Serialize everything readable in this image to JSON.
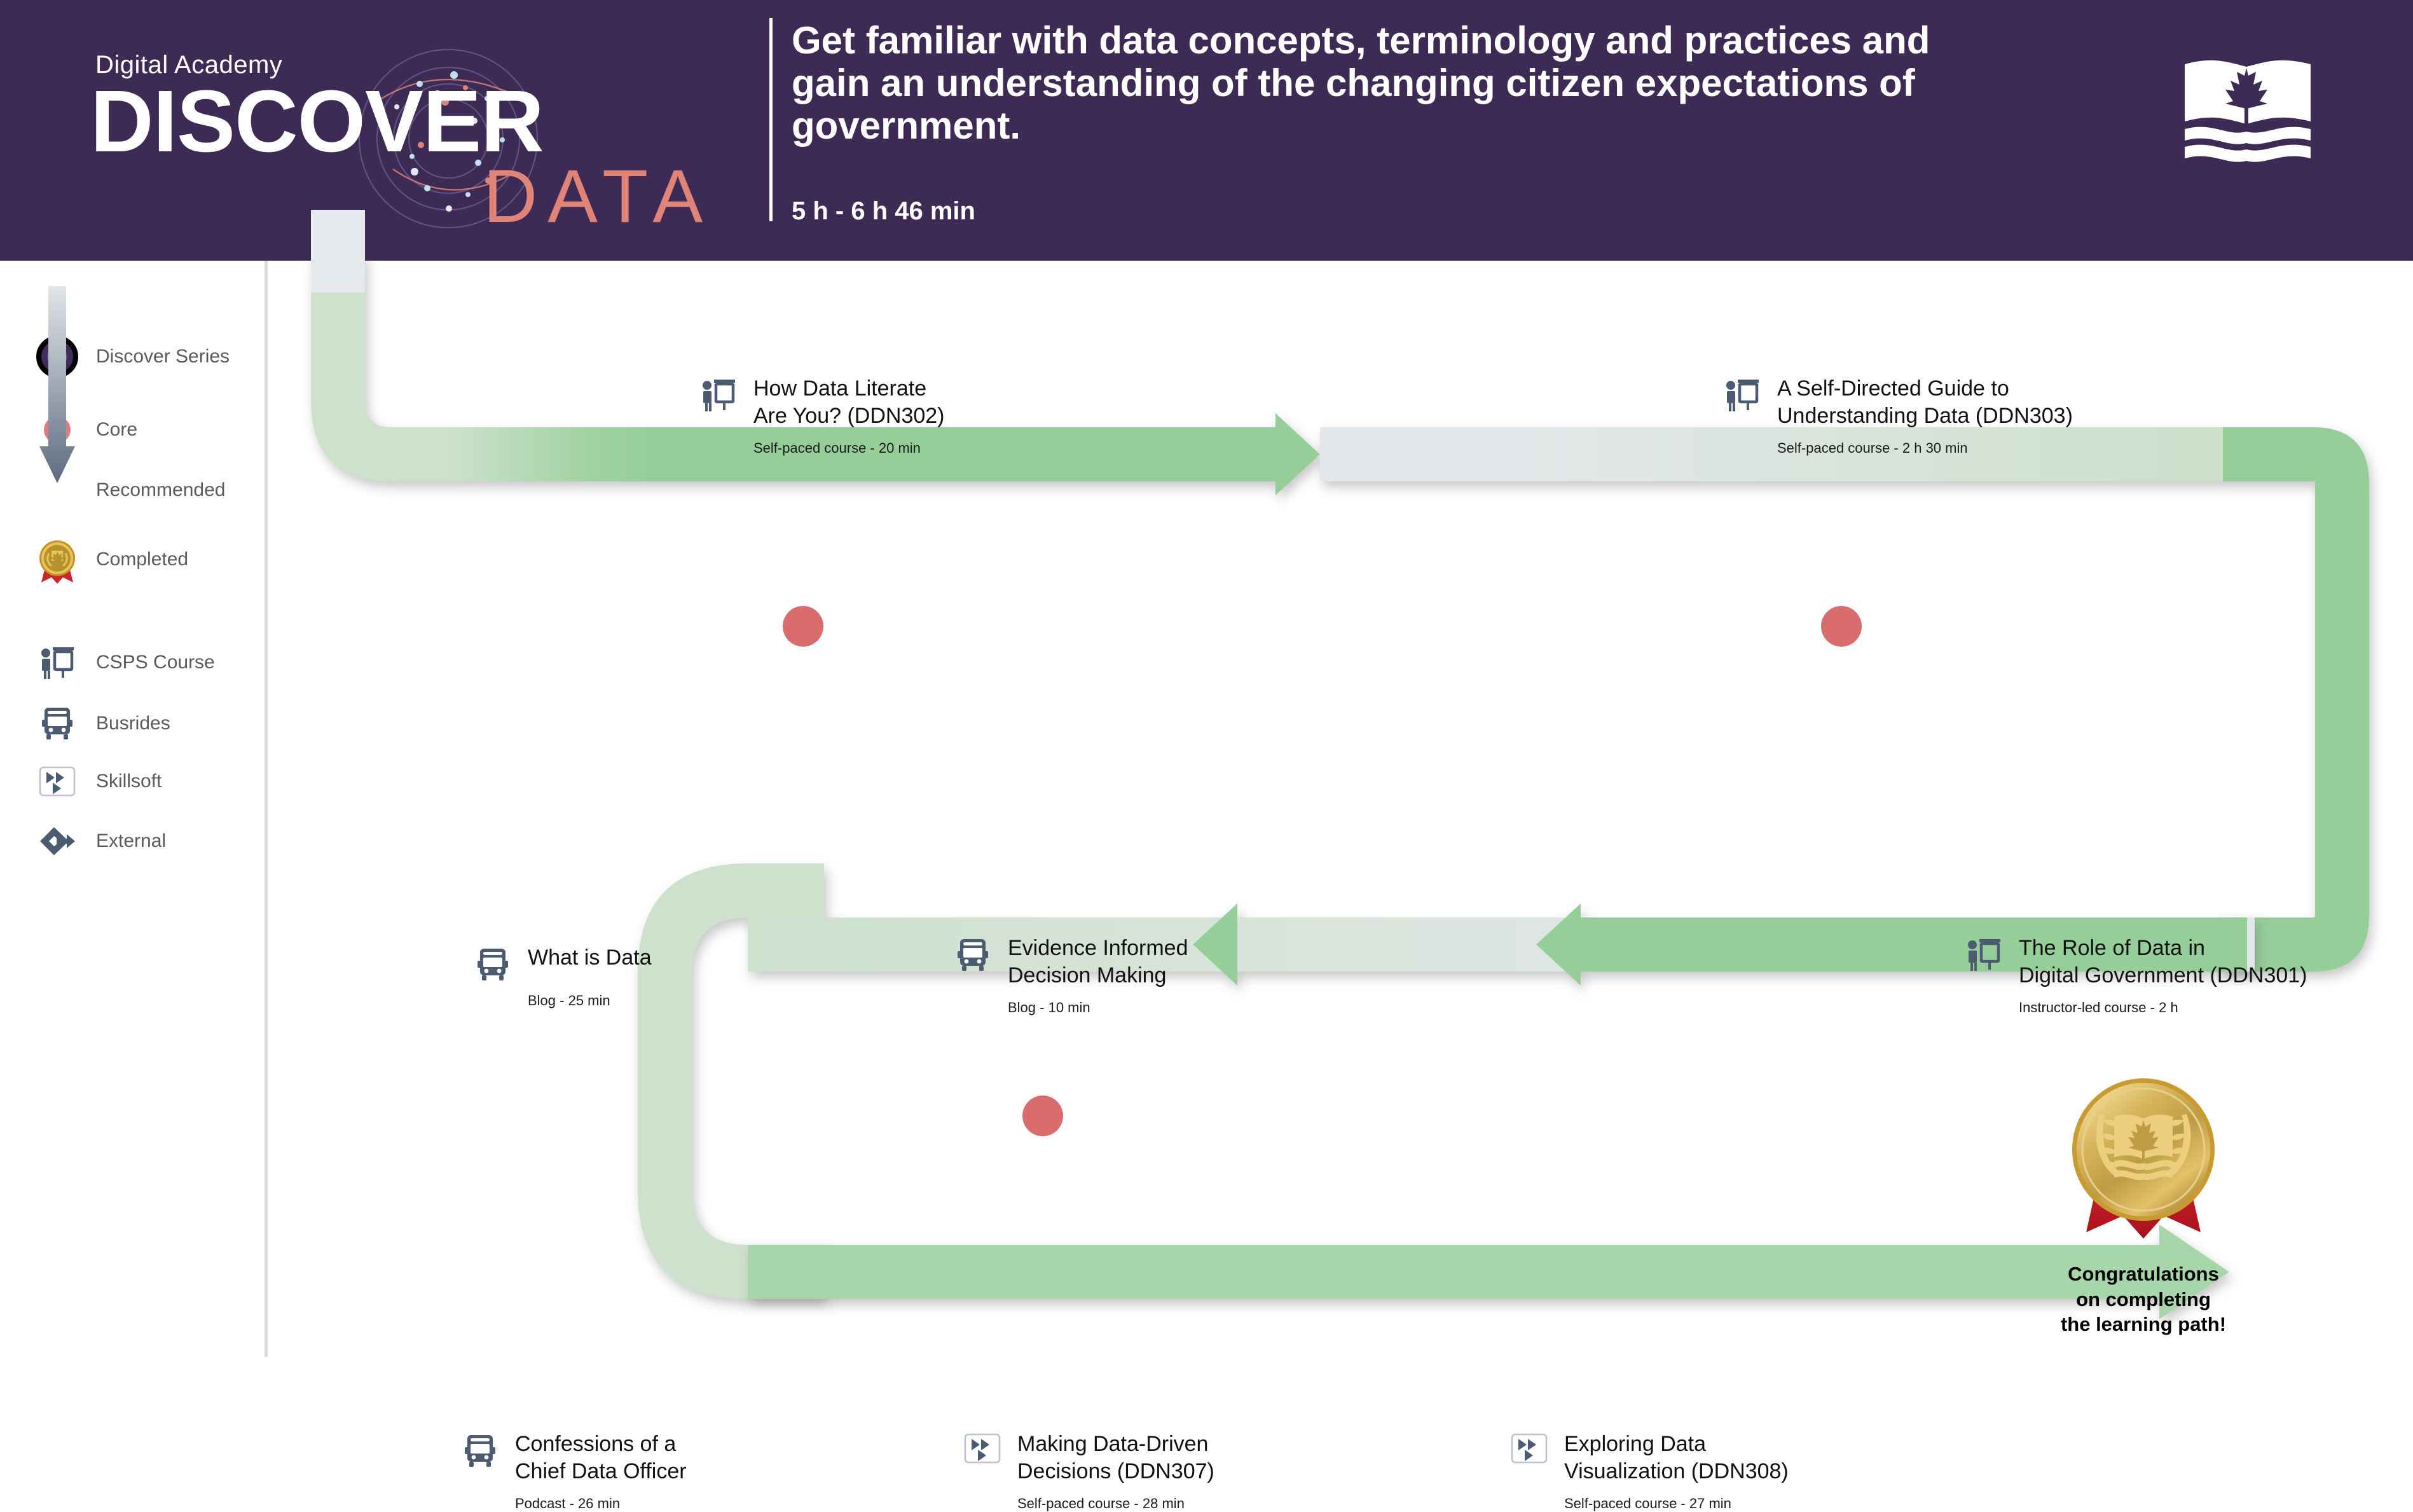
{
  "header": {
    "brand_kicker": "Digital Academy",
    "brand_main": "DISCOVER",
    "brand_accent": "DATA",
    "title": "Get familiar with data concepts, terminology and practices and gain an understanding of the changing citizen expectations of government.",
    "duration": "5 h - 6 h 46 min",
    "org_logo_name": "CSPS book-and-maple-leaf logo",
    "bg_color": "#3D2B56",
    "accent_color": "#E08478"
  },
  "legend": {
    "status": [
      {
        "label": "Discover\nSeries",
        "icon": "discover-series-orb-icon"
      },
      {
        "label": "Core",
        "icon": "core-dot-icon",
        "color": "#DD7D7D"
      },
      {
        "label": "Recommended",
        "icon": "recommended-dot-icon",
        "color": "#FFFFFF"
      },
      {
        "label": "Completed",
        "icon": "completed-medal-icon",
        "color": "#D8A12B"
      }
    ],
    "types": [
      {
        "label": "CSPS Course",
        "icon": "csps-course-icon"
      },
      {
        "label": "Busrides",
        "icon": "bus-icon"
      },
      {
        "label": "Skillsoft",
        "icon": "skillsoft-play-icon"
      },
      {
        "label": "External",
        "icon": "external-link-icon"
      }
    ]
  },
  "path": {
    "completion": {
      "caption": "Congratulations\non completing\nthe learning path!",
      "icon": "gold-medal-ribbon-icon"
    },
    "courses": [
      {
        "title": "How Data Literate\nAre You? (DDN302)",
        "meta": "Self-paced course - 20 min",
        "icon": "csps-course-icon",
        "status": "core"
      },
      {
        "title": "A Self-Directed Guide to\nUnderstanding Data (DDN303)",
        "meta": "Self-paced course - 2 h 30 min",
        "icon": "csps-course-icon",
        "status": "core"
      },
      {
        "title": "The Role of Data in\nDigital Government (DDN301)",
        "meta": "Instructor-led course - 2 h",
        "icon": "csps-course-icon",
        "status": "core"
      },
      {
        "title": "Evidence Informed\nDecision Making",
        "meta": "Blog - 10 min",
        "icon": "bus-icon",
        "status": "core"
      },
      {
        "title": "What is Data",
        "meta": "Blog - 25 min",
        "icon": "bus-icon",
        "status": "recommended"
      },
      {
        "title": "Confessions of a\nChief Data Officer",
        "meta": "Podcast - 26 min",
        "icon": "bus-icon",
        "status": "recommended"
      },
      {
        "title": "Making Data-Driven\nDecisions (DDN307)",
        "meta": "Self-paced course - 28 min",
        "icon": "skillsoft-play-icon",
        "status": "recommended"
      },
      {
        "title": "Exploring Data\nVisualization (DDN308)",
        "meta": "Self-paced course - 27 min",
        "icon": "skillsoft-play-icon",
        "status": "recommended"
      }
    ]
  },
  "colors": {
    "track_green": "#97CE9B",
    "track_pale": "#CEE1CD",
    "track_grey": "#E3E7E9",
    "icon_slate": "#4C5A72",
    "core_red": "#D96C6C"
  }
}
